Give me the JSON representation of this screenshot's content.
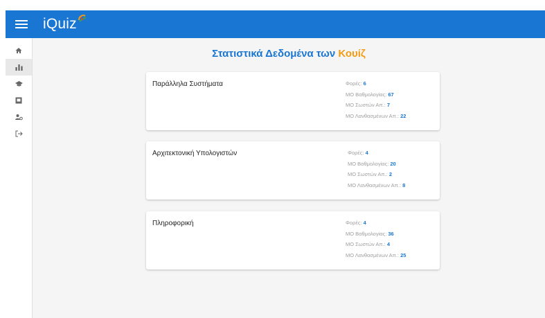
{
  "app": {
    "name": "iQuiz",
    "brand_color": "#1976d2",
    "accent_color": "#f39c12"
  },
  "header": {
    "menu_icon": "hamburger-icon"
  },
  "sidebar": {
    "items": [
      {
        "icon": "home-icon"
      },
      {
        "icon": "bar-chart-icon",
        "active": true
      },
      {
        "icon": "graduation-cap-icon"
      },
      {
        "icon": "quiz-book-icon"
      },
      {
        "icon": "users-settings-icon"
      },
      {
        "icon": "logout-icon"
      }
    ]
  },
  "page": {
    "title_main": "Στατιστικά Δεδομένα των",
    "title_accent": "Κουίζ"
  },
  "labels": {
    "attempts": "Φορές:",
    "avg_score": "ΜΟ Βαθμολογίας:",
    "avg_correct": "ΜΟ Σωστών Απ.:",
    "avg_wrong": "ΜΟ Λανθασμένων Απ.:"
  },
  "quizzes": [
    {
      "name": "Παράλληλα Συστήματα",
      "attempts": "6",
      "avg_score": "67",
      "avg_correct": "7",
      "avg_wrong": "22"
    },
    {
      "name": "Αρχιτεκτονική Υπολογιστών",
      "attempts": "4",
      "avg_score": "20",
      "avg_correct": "2",
      "avg_wrong": "8"
    },
    {
      "name": "Πληροφορική",
      "attempts": "4",
      "avg_score": "36",
      "avg_correct": "4",
      "avg_wrong": "25"
    }
  ]
}
